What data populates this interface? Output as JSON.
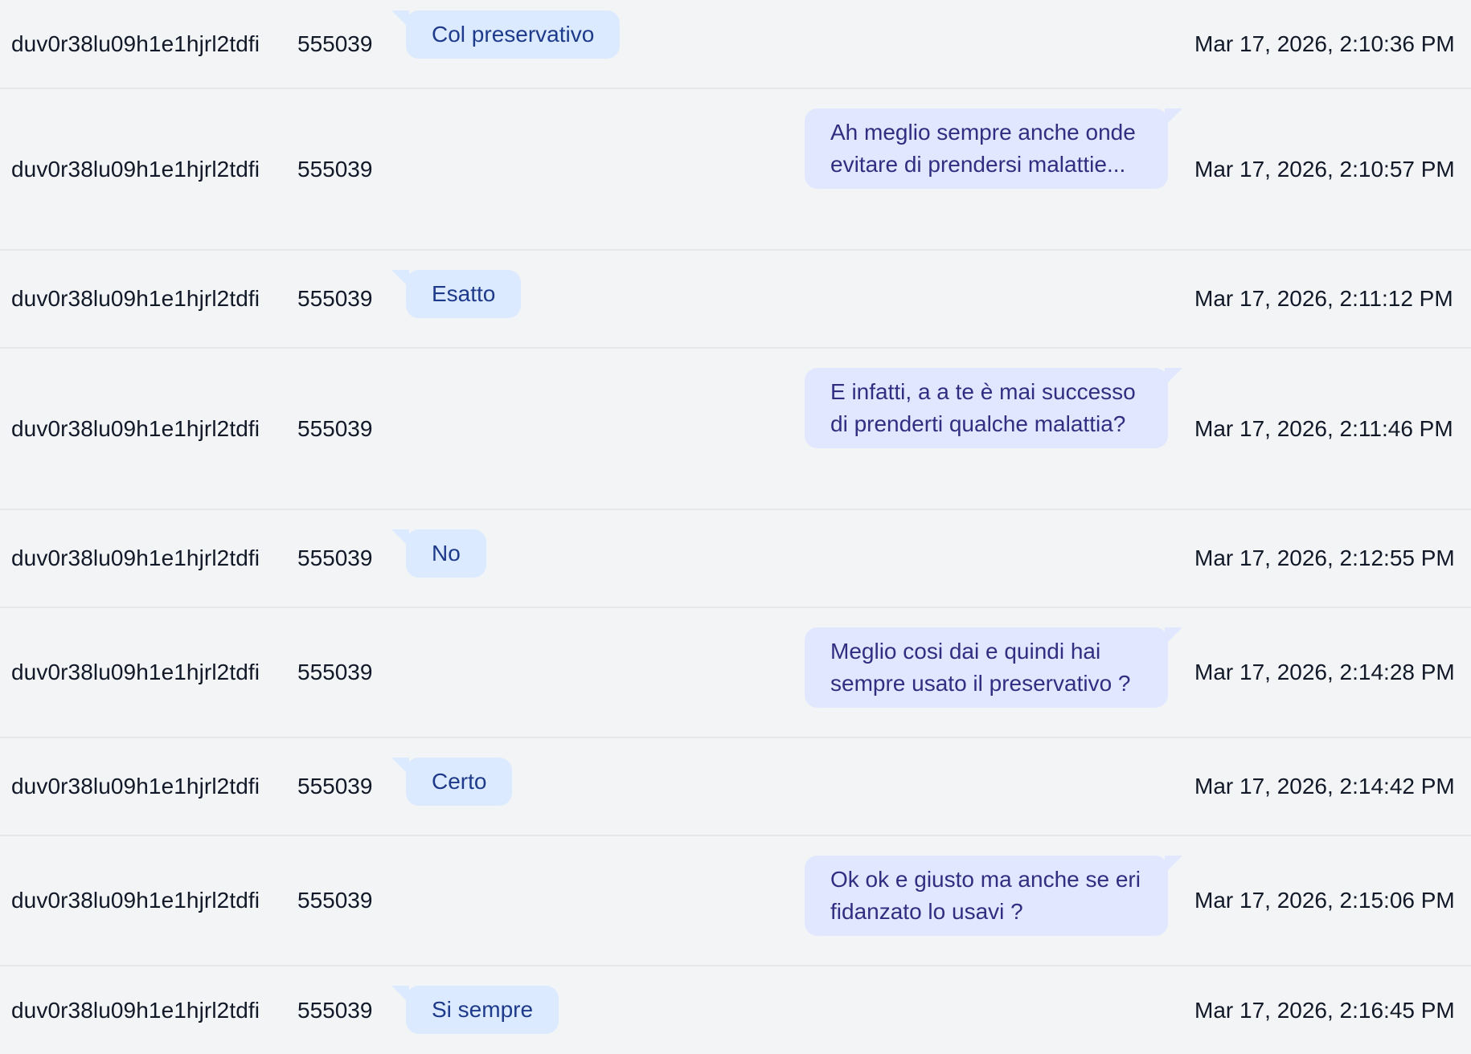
{
  "messages": [
    {
      "session_id": "duv0r38lu09h1e1hjrl2tdfi",
      "user_id": "555039",
      "side": "left",
      "text": "Col preservativo",
      "timestamp": "Mar 17, 2026, 2:10:36 PM"
    },
    {
      "session_id": "duv0r38lu09h1e1hjrl2tdfi",
      "user_id": "555039",
      "side": "right",
      "text": "Ah meglio sempre anche onde evitare di prendersi malattie...",
      "timestamp": "Mar 17, 2026, 2:10:57 PM"
    },
    {
      "session_id": "duv0r38lu09h1e1hjrl2tdfi",
      "user_id": "555039",
      "side": "left",
      "text": "Esatto",
      "timestamp": "Mar 17, 2026, 2:11:12 PM"
    },
    {
      "session_id": "duv0r38lu09h1e1hjrl2tdfi",
      "user_id": "555039",
      "side": "right",
      "text": "E infatti, a a te è mai successo di prenderti qualche malattia?",
      "timestamp": "Mar 17, 2026, 2:11:46 PM"
    },
    {
      "session_id": "duv0r38lu09h1e1hjrl2tdfi",
      "user_id": "555039",
      "side": "left",
      "text": "No",
      "timestamp": "Mar 17, 2026, 2:12:55 PM"
    },
    {
      "session_id": "duv0r38lu09h1e1hjrl2tdfi",
      "user_id": "555039",
      "side": "right",
      "text": "Meglio cosi dai e quindi hai sempre usato il preservativo ?",
      "timestamp": "Mar 17, 2026, 2:14:28 PM"
    },
    {
      "session_id": "duv0r38lu09h1e1hjrl2tdfi",
      "user_id": "555039",
      "side": "left",
      "text": "Certo",
      "timestamp": "Mar 17, 2026, 2:14:42 PM"
    },
    {
      "session_id": "duv0r38lu09h1e1hjrl2tdfi",
      "user_id": "555039",
      "side": "right",
      "text": "Ok ok e giusto ma anche se eri fidanzato lo usavi ?",
      "timestamp": "Mar 17, 2026, 2:15:06 PM"
    },
    {
      "session_id": "duv0r38lu09h1e1hjrl2tdfi",
      "user_id": "555039",
      "side": "left",
      "text": "Si sempre",
      "timestamp": "Mar 17, 2026, 2:16:45 PM"
    }
  ]
}
